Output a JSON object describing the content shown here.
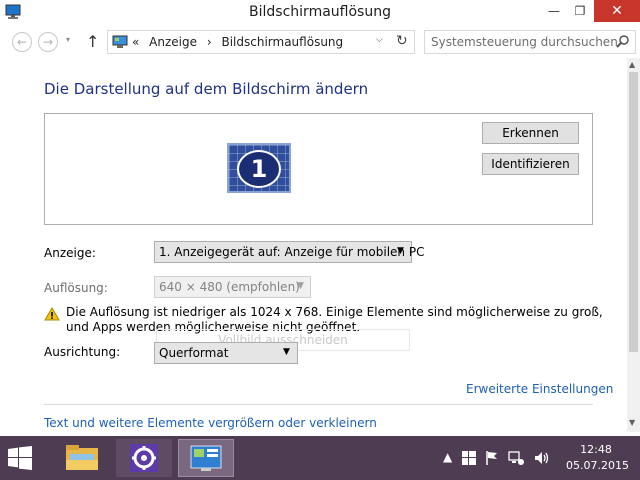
{
  "window": {
    "title": "Bildschirmauflösung",
    "minimize_glyph": "—",
    "maximize_glyph": "❐",
    "close_glyph": "✕"
  },
  "nav": {
    "back_glyph": "←",
    "forward_glyph": "→",
    "history_glyph": "▾",
    "up_glyph": "↑",
    "breadcrumb_prefix": "«",
    "breadcrumbs": [
      "Anzeige",
      "Bildschirmauflösung"
    ],
    "breadcrumb_sep": "›",
    "dropdown_glyph": "⌵",
    "refresh_glyph": "↻",
    "search_placeholder": "Systemsteuerung durchsuchen"
  },
  "main": {
    "heading": "Die Darstellung auf dem Bildschirm ändern",
    "monitor_number": "1",
    "detect_button": "Erkennen",
    "identify_button": "Identifizieren",
    "display_label": "Anzeige:",
    "display_value": "1. Anzeigegerät auf: Anzeige für mobilen PC",
    "resolution_label": "Auflösung:",
    "resolution_value": "640 × 480 (empfohlen)",
    "warning_text": "Die Auflösung ist niedriger als 1024 x 768. Einige Elemente sind möglicherweise zu groß, und Apps werden möglicherweise nicht geöffnet.",
    "ghost_button": "Vollbild ausschneiden",
    "orientation_label": "Ausrichtung:",
    "orientation_value": "Querformat",
    "select_arrow": "▼",
    "advanced_link": "Erweiterte Einstellungen",
    "text_size_link": "Text und weitere Elemente vergrößern oder verkleinern"
  },
  "taskbar": {
    "clock_time": "12:48",
    "clock_date": "05.07.2015",
    "tray_chevron": "▲"
  },
  "colors": {
    "heading": "#1e3287",
    "link": "#1e5fb4",
    "taskbar": "#4e3d52",
    "close_button": "#c7352b"
  }
}
